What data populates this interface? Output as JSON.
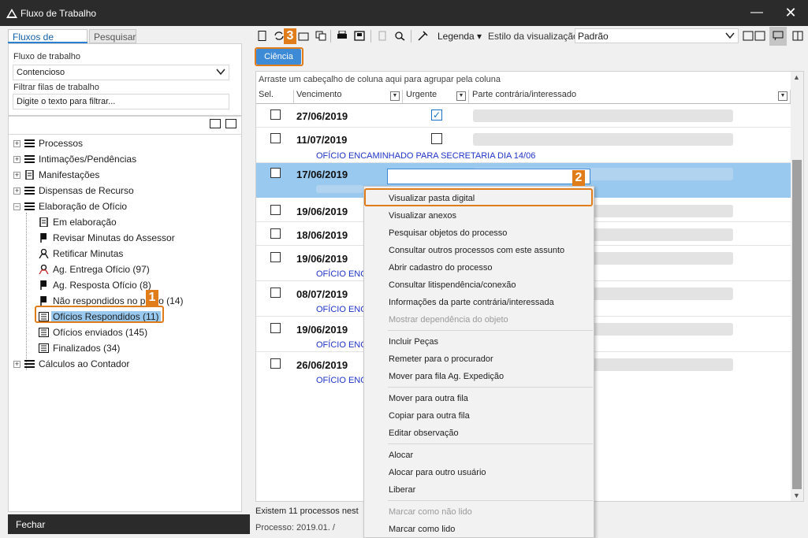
{
  "window": {
    "title": "Fluxo de Trabalho",
    "minimize": "—",
    "close": "✕"
  },
  "left": {
    "tabs": [
      "Fluxos de trabalho",
      "Pesquisar"
    ],
    "workflow_label": "Fluxo de trabalho",
    "workflow_value": "Contencioso",
    "filter_label": "Filtrar filas de trabalho",
    "filter_placeholder": "Digite o texto para filtrar...",
    "tree": [
      {
        "label": "Processos",
        "expander": "+",
        "icon": "list-icon"
      },
      {
        "label": "Intimações/Pendências",
        "expander": "+",
        "icon": "list-icon"
      },
      {
        "label": "Manifestações",
        "expander": "+",
        "icon": "document-icon"
      },
      {
        "label": "Dispensas de Recurso",
        "expander": "+",
        "icon": "list-icon"
      },
      {
        "label": "Elaboração de Ofício",
        "expander": "−",
        "icon": "list-icon"
      },
      {
        "label": "Em elaboração",
        "icon": "document-icon"
      },
      {
        "label": "Revisar Minutas do Assessor",
        "icon": "flag-icon"
      },
      {
        "label": "Retificar Minutas",
        "icon": "person-icon"
      },
      {
        "label": "Ag. Entrega Ofício (97)",
        "icon": "person-red-icon"
      },
      {
        "label": "Ag. Resposta Ofício (8)",
        "icon": "flag-icon"
      },
      {
        "label": "Não respondidos no prazo (14)",
        "icon": "flag-icon"
      },
      {
        "label": "Ofícios Respondidos (11)",
        "icon": "inbox-icon"
      },
      {
        "label": "Ofícios enviados (145)",
        "icon": "inbox-icon"
      },
      {
        "label": "Finalizados (34)",
        "icon": "inbox-icon"
      },
      {
        "label": "Cálculos ao Contador",
        "expander": "+",
        "icon": "list-icon"
      }
    ],
    "close_button": "Fechar"
  },
  "toolbar": {
    "legenda": "Legenda ▾",
    "estilo_label": "Estilo da visualização",
    "estilo_value": "Padrão",
    "ciencia": "Ciência"
  },
  "badges": {
    "one": "1",
    "two": "2",
    "three": "3"
  },
  "grid": {
    "group_hint": "Arraste um cabeçalho de coluna aqui para agrupar pela coluna",
    "columns": [
      "Sel.",
      "Vencimento",
      "Urgente",
      "Parte contrária/interessado"
    ],
    "rows": [
      {
        "date": "27/06/2019",
        "urgent": true,
        "note": ""
      },
      {
        "date": "11/07/2019",
        "urgent": false,
        "note": "OFÍCIO ENCAMINHADO PARA SECRETARIA DIA 14/06"
      },
      {
        "date": "17/06/2019",
        "urgent": false,
        "note": ""
      },
      {
        "date": "19/06/2019",
        "urgent": false,
        "note": ""
      },
      {
        "date": "18/06/2019",
        "urgent": false,
        "note": ""
      },
      {
        "date": "19/06/2019",
        "urgent": false,
        "note": "OFÍCIO ENC"
      },
      {
        "date": "08/07/2019",
        "urgent": false,
        "note": "OFÍCIO ENC"
      },
      {
        "date": "19/06/2019",
        "urgent": false,
        "note": "OFÍCIO ENC"
      },
      {
        "date": "26/06/2019",
        "urgent": false,
        "note": "OFÍCIO ENC"
      }
    ],
    "status_count": "Existem 11 processos nest",
    "status_process": "Processo: 2019.01.           /"
  },
  "context_menu": [
    {
      "label": "Visualizar pasta digital"
    },
    {
      "label": "Visualizar anexos"
    },
    {
      "label": "Pesquisar objetos do processo"
    },
    {
      "label": "Consultar outros processos com este assunto"
    },
    {
      "label": "Abrir cadastro do processo"
    },
    {
      "label": "Consultar litispendência/conexão"
    },
    {
      "label": "Informações da parte contrária/interessada"
    },
    {
      "label": "Mostrar dependência do objeto",
      "disabled": true
    },
    {
      "label": "Incluir Peças"
    },
    {
      "label": "Remeter para o procurador"
    },
    {
      "label": "Mover para fila Ag. Expedição"
    },
    {
      "label": "Mover para outra fila"
    },
    {
      "label": "Copiar para outra fila"
    },
    {
      "label": "Editar observação"
    },
    {
      "label": "Alocar"
    },
    {
      "label": "Alocar para outro usuário"
    },
    {
      "label": "Liberar"
    },
    {
      "label": "Marcar como não lido",
      "disabled": true
    },
    {
      "label": "Marcar como lido"
    }
  ],
  "colors": {
    "accent": "#3d8ad6",
    "annotation": "#e07c1a",
    "selection": "#99c9ef",
    "note_text": "#1f33c8"
  }
}
